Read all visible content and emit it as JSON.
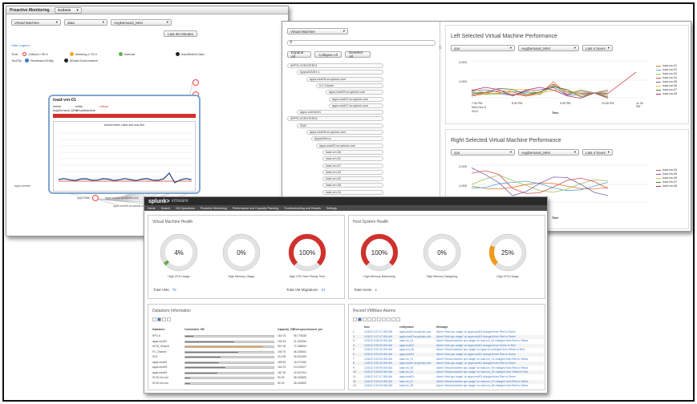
{
  "w1": {
    "title": "Proactive Monitoring",
    "title_select": "Actions",
    "filter1": "Virtual Machine",
    "filter2": "data",
    "filter3": "AvgDemand_MHz",
    "time_range": "Last 30 minutes",
    "hide_legend": "Hide Legend",
    "tree_label": "Tree:",
    "legend_critical": "Critical ≥ 90.0",
    "legend_warning": "Warning ≥ 75.0",
    "legend_normal": "Normal",
    "legend_insufficient": "Insufficient Data",
    "tooltip_label": "ToolTip:",
    "tooltip_reviewed": "Reviewed Entity",
    "tooltip_whole": "Whole Environment",
    "popup_title": "load-vm-01",
    "popup_metric_h": "metric",
    "popup_entity_h": "entity",
    "popup_status_h": "critical",
    "popup_metric": "AvgDemand_MHz",
    "popup_entity": "VirtualMachine",
    "popup_chart_title": "Actual metric value and max line",
    "node_a": "apps-vcenter",
    "node_b": "apps-host",
    "node_c": "apps-esxi02.sv.splunk.com",
    "node_d": "apps-esxi06.sv.splunk.com"
  },
  "w2": {
    "tree_select": "Virtual Machine",
    "expand_all": "Expand All",
    "collapse_all": "Collapse All",
    "deselect_all": "Deselect All",
    "tree": [
      "APPS-VCENTER01",
      "AppsvDASH-1",
      "apps-esxi06.sv.splunk.com",
      "5.1 Cluster",
      "apps-esxi09.sv.splunk.com",
      "apps-esxi02.sv.splunk.com",
      "apps-esxi07.sv.splunk.com",
      "apps-vcenter01",
      "APPS-VCENTER02",
      "SUB",
      "apps-esxi08.sv.splunk.com",
      "AppsvDemo",
      "apps-esxi02.sv.splunk.com",
      "load-vm-06",
      "load-vm-01",
      "load-vm-07",
      "load-vm-03",
      "load-vm-02",
      "load-vm-08",
      "load-vm-04",
      "load-vm-05"
    ],
    "left_title": "Left Selected Virtual Machine Performance",
    "right_title": "Right Selected Virtual Machine Performance",
    "sel_cpu": "cpu",
    "sel_metric": "AvgDemand_MHz",
    "sel_time": "Last 4 hours",
    "y_2000": "2,000",
    "y_1000": "1,000",
    "x_ticks": [
      "7:30 PM",
      "8:30 PM",
      "9:30 PM",
      "10:30 PM",
      "11:30 PM"
    ],
    "x_sub": "Wed Dec 5",
    "x_sub2": "2012",
    "x_title": "Time",
    "left_legend": [
      "load-vm-01",
      "load-vm-02",
      "load-vm-03",
      "load-vm-04",
      "load-vm-05",
      "load-vm-06",
      "load-vm-07",
      "load-vm-08"
    ],
    "right_legend": [
      "load-vm-04",
      "load-vm-05",
      "load-vm-06",
      "load-vm-07",
      "load-vm-08"
    ]
  },
  "w3": {
    "brand": "splunk>",
    "brand_app": "vmware",
    "menu": [
      "Home",
      "Search",
      "VM Operations",
      "Proactive Monitoring",
      "Performance and Capacity Planning",
      "Troubleshooting and Results",
      "Settings"
    ],
    "vm_health_title": "Virtual Machine Health",
    "host_health_title": "Host System Health",
    "gauges_vm": [
      {
        "pct": "4%",
        "label": "High CPU Usage",
        "value": 0.04,
        "color": "#65a844"
      },
      {
        "pct": "0%",
        "label": "High Memory Usage",
        "value": 0,
        "color": "#65a844"
      },
      {
        "pct": "100%",
        "label": "High CPU Sum Ready Time",
        "value": 1,
        "color": "#d0312d"
      }
    ],
    "gauges_host": [
      {
        "pct": "100%",
        "label": "High Memory Ballooning",
        "value": 1,
        "color": "#d0312d"
      },
      {
        "pct": "0%",
        "label": "High Memory Swapping",
        "value": 0,
        "color": "#65a844"
      },
      {
        "pct": "25%",
        "label": "High CPU Usage",
        "value": 0.25,
        "color": "#f09a1c"
      }
    ],
    "total_vms_label": "Total VMs",
    "total_vms": "75",
    "total_migrations_label": "Total VM Migrations",
    "total_migrations": "21",
    "total_hosts_label": "Total Hosts",
    "total_hosts": "4",
    "datastore_title": "Datastore Information",
    "ds_col1": "Datastore",
    "ds_col2": "Committed_GB",
    "ds_col3": "Capacity_GB",
    "ds_col4": "Oversprovisioned_pct",
    "datastores": [
      {
        "name": "RFS-5",
        "val": 0.09,
        "cap": "164.75",
        "pct": "95.774539"
      },
      {
        "name": "apps-esxi01",
        "val": 0.55,
        "cap": "190.44",
        "pct": "21.003254"
      },
      {
        "name": "NCIS_Shared",
        "val": 0.88,
        "cap": "997.00",
        "pct": "72.338004"
      },
      {
        "name": "FC_Shared",
        "val": 0.6,
        "cap": "159.75",
        "pct": "46.234551"
      },
      {
        "name": "SD1",
        "val": 0.4,
        "cap": "214.50",
        "pct": "30.901309"
      },
      {
        "name": "apps-esxi02",
        "val": 0.38,
        "cap": "189.50",
        "pct": "18.271300"
      },
      {
        "name": "apps-esxi03",
        "val": 0.45,
        "cap": "164.75",
        "pct": "24.193117"
      },
      {
        "name": "apps-esxi04",
        "val": 0.36,
        "cap": "187.50",
        "pct": "16.027201"
      },
      {
        "name": "SCSI-Vol-xxx",
        "val": 0.05,
        "cap": "50.00",
        "pct": "38.181800"
      },
      {
        "name": "SCSI-Vol-xxx",
        "val": 0.05,
        "cap": "50.00",
        "pct": "38.181800"
      }
    ],
    "alarms_title": "Recent VMWare Alarms",
    "al_col1": "time",
    "al_col2": "entityname",
    "al_col3": "Message",
    "alarms": [
      {
        "t": "12/6/12 9:27:47.000 AM",
        "e": "apps-esxi03.sv.splunk.com",
        "m": "Alarm 'Host cpu usage' on apps-esxi03 changed from Red to Green"
      },
      {
        "t": "12/6/12 9:27:47.000 AM",
        "e": "apps-esxi03.sv.splunk.com",
        "m": "Alarm 'Host cpu usage' on apps-esxi03 changed from Red to Green"
      },
      {
        "t": "12/6/12 9:26:09.000 AM",
        "e": "load-vm_04",
        "m": "Alarm 'Virtual machine cpu usage' on load-vm_04 changed from Red to Yellow"
      },
      {
        "t": "12/6/12 9:25:09.000 AM",
        "e": "apps-esxi02",
        "m": "Alarm 'Host cpu usage' on apps-esxi02 changed from Green to Red"
      },
      {
        "t": "12/6/12 9:24:40.000 AM",
        "e": "apps-vm_06",
        "m": "Alarm 'Virtual machine cpu usage' on apps-vm changed from Yellow to Red"
      },
      {
        "t": "12/6/12 9:23:09.000 AM",
        "e": "apps-esxi04",
        "m": "Alarm 'Host cpu usage' on apps-esxi04 changed from Red to Green"
      },
      {
        "t": "12/6/12 9:22:09.000 AM",
        "e": "load-vm_01",
        "m": "Alarm 'Virtual machine cpu usage' on load-vm_01 changed from Red to Yellow"
      },
      {
        "t": "12/6/12 9:20:40.000 AM",
        "e": "apps-esxi01.sv.splunk.com",
        "m": "Alarm 'Host cpu usage' on apps-esxi01 changed from Red to Green"
      },
      {
        "t": "12/6/12 9:19:09.000 AM",
        "e": "load-vm_05",
        "m": "Alarm 'Virtual machine cpu usage' on load-vm_05 changed from Red to Yellow"
      },
      {
        "t": "12/6/12 9:18:09.000 AM",
        "e": "load-vm_02",
        "m": "Alarm 'Virtual machine cpu usage' on load-vm_02 changed from Yellow to Red"
      },
      {
        "t": "12/6/12 9:17:47.000 AM",
        "e": "apps-esxi03",
        "m": "Alarm 'Host cpu usage' on apps-esxi03 changed from Red to Green"
      },
      {
        "t": "12/6/12 9:16:09.000 AM",
        "e": "load-vm_07",
        "m": "Alarm 'Virtual machine cpu usage' on load-vm_07 changed from Red to Yellow"
      },
      {
        "t": "12/6/12 9:15:09.000 AM",
        "e": "load-vm_08",
        "m": "Alarm 'Virtual machine cpu usage' on load-vm_08 changed from Red to Yellow"
      }
    ]
  }
}
